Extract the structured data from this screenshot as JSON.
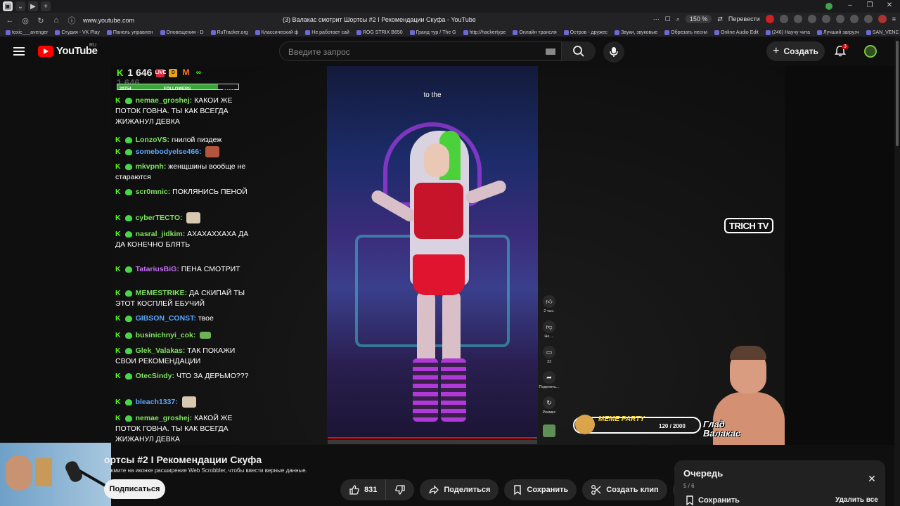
{
  "browser": {
    "url": "www.youtube.com",
    "page_title": "(3) Валакас смотрит Шортсы #2 I Рекомендации Скуфа - YouTube",
    "zoom": "150 %",
    "translate_label": "Перевести",
    "bookmarks": [
      "toxic___avenger",
      "Студия - VK Play",
      "Панель управлен",
      "Оповещения - D",
      "RuTracker.org",
      "Классический ф",
      "Не работает сай",
      "ROG STRIX B650",
      "Гранд тур / The G",
      "http://hackertype",
      "Онлайн трансля",
      "Остров - дружес",
      "Звуки, звуковые",
      "Обрезать песни",
      "Online Audio Edit",
      "(246) Научу чита",
      "Лучший загрузч",
      "SAN_VENC"
    ]
  },
  "header": {
    "logo_text": "YouTube",
    "region": "RU",
    "search_placeholder": "Введите запрос",
    "create_label": "Создать",
    "notification_count": "3"
  },
  "overlay": {
    "followers_count": "1 646",
    "followers_ghost": "1 646",
    "followers_bar": {
      "current": "20754",
      "label": "FOLLOWERS",
      "target": "25000",
      "fraction": 0.83
    },
    "trich_logo": "TRICH TV",
    "meme_party_title": "MEME PARTY",
    "meme_party_count": "120 / 2000",
    "streamer_name_line1": "Глад",
    "streamer_name_line2": "Валакас"
  },
  "chat": [
    {
      "user": "nemae_groshej",
      "color": "green",
      "text": "КАКОИ ЖЕ ПОТОК ГОВНА. ТЫ КАК ВСЕГДА ЖИЖАНУЛ ДЕВКА",
      "emote": ""
    },
    {
      "user": "LonzoVS",
      "color": "green",
      "text": "гнилой пиздеж",
      "emote": ""
    },
    {
      "user": "somebodyelse466",
      "color": "blue",
      "text": "",
      "emote": "red"
    },
    {
      "user": "mkvpnh",
      "color": "green",
      "text": "женщшины вообще не стараются",
      "emote": ""
    },
    {
      "user": "scr0mnic",
      "color": "green",
      "text": "ПОКЛЯНИСЬ ПЕНОЙ",
      "emote": ""
    },
    {
      "user": "cyberTECTO",
      "color": "green",
      "text": "",
      "emote": "pale"
    },
    {
      "user": "nasral_jidkim",
      "color": "green",
      "text": "АХАХАХХАХА ДА ДА КОНЕЧНО БЛЯТЬ",
      "emote": ""
    },
    {
      "user": "TatariusBiG",
      "color": "purple",
      "text": "ПЕНА СМОТРИТ",
      "emote": ""
    },
    {
      "user": "MEMESTRIKE",
      "color": "green",
      "text": "ДА СКИПАЙ ТЫ ЭТОТ КОСПЛЕЙ ЕБУЧИЙ",
      "emote": ""
    },
    {
      "user": "GIBSON_CONST",
      "color": "blue",
      "text": "твое",
      "emote": ""
    },
    {
      "user": "businichnyi_cok",
      "color": "green",
      "text": "",
      "emote": "green"
    },
    {
      "user": "Glek_Valakas",
      "color": "green",
      "text": "ТАК ПОКАЖИ СВОИ РЕКОМЕНДАЦИИ",
      "emote": ""
    },
    {
      "user": "OtecSindy",
      "color": "green",
      "text": "ЧТО ЗА ДЕРЬМО???",
      "emote": ""
    },
    {
      "user": "bleach1337",
      "color": "blue",
      "text": "",
      "emote": "pale"
    },
    {
      "user": "nemae_groshej",
      "color": "green",
      "text": "КАКОЙ ЖЕ ПОТОК ГОВНА. ТЫ КАК ВСЕГДА ЖИЖАНУЛ ДЕВКА",
      "emote": ""
    }
  ],
  "short": {
    "caption": "to the",
    "progress": 0.98,
    "actions": [
      {
        "icon": "thumb-up-icon",
        "label": "2 тыс."
      },
      {
        "icon": "thumb-down-icon",
        "label": "Не ..."
      },
      {
        "icon": "comment-icon",
        "label": "33"
      },
      {
        "icon": "share-icon",
        "label": "Поделить..."
      },
      {
        "icon": "remix-icon",
        "label": "Ремикс"
      }
    ]
  },
  "video": {
    "title": "ортсы #2 I Рекомендации Скуфа",
    "scrobbler_notice": "жмите на иконке расширения Web Scrobbler, чтобы ввести верные данные.",
    "subscribe_label": "Подписаться",
    "like_count": "831",
    "share_label": "Поделиться",
    "save_label": "Сохранить",
    "clip_label": "Создать клип"
  },
  "queue": {
    "title": "Очередь",
    "count": "5 / 6",
    "save_label": "Сохранить",
    "remove_all_label": "Удалить все"
  }
}
